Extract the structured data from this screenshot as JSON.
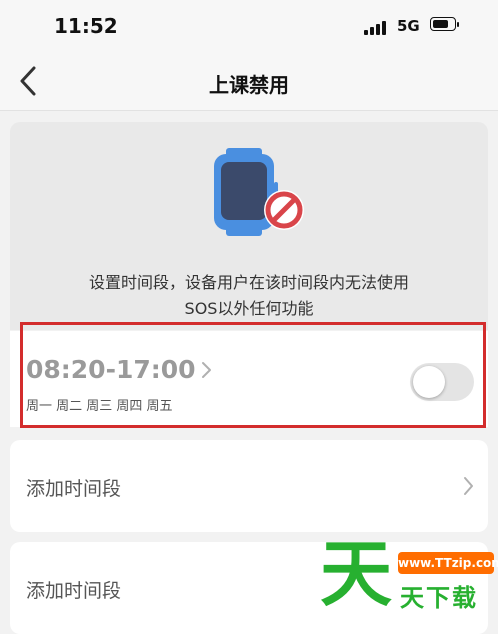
{
  "status_bar": {
    "time": "11:52",
    "network": "5G",
    "icons": [
      "signal-bars-icon",
      "battery-icon"
    ]
  },
  "nav": {
    "title": "上课禁用",
    "back_icon": "chevron-left-icon"
  },
  "hero": {
    "illustration_icon": "watch-prohibited-icon",
    "description_line1": "设置时间段，设备用户在该时间段内无法使用",
    "description_line2": "SOS以外任何功能"
  },
  "schedule": {
    "time_range": "08:20-17:00",
    "days": "周一 周二 周三 周四 周五",
    "enabled": false
  },
  "rows": [
    {
      "label": "添加时间段"
    },
    {
      "label": "添加时间段"
    }
  ],
  "watermark": {
    "big_char": "天",
    "url": "www.TTzip.com",
    "text": "天下载"
  },
  "colors": {
    "accent_blue": "#4a8fe0",
    "watch_face": "#3b4a6b",
    "prohibit_red": "#d9454a",
    "highlight_red": "#d32c2c",
    "toggle_off": "#e4e4e4",
    "watermark_green": "#27b030",
    "watermark_orange": "#ff6d00"
  }
}
